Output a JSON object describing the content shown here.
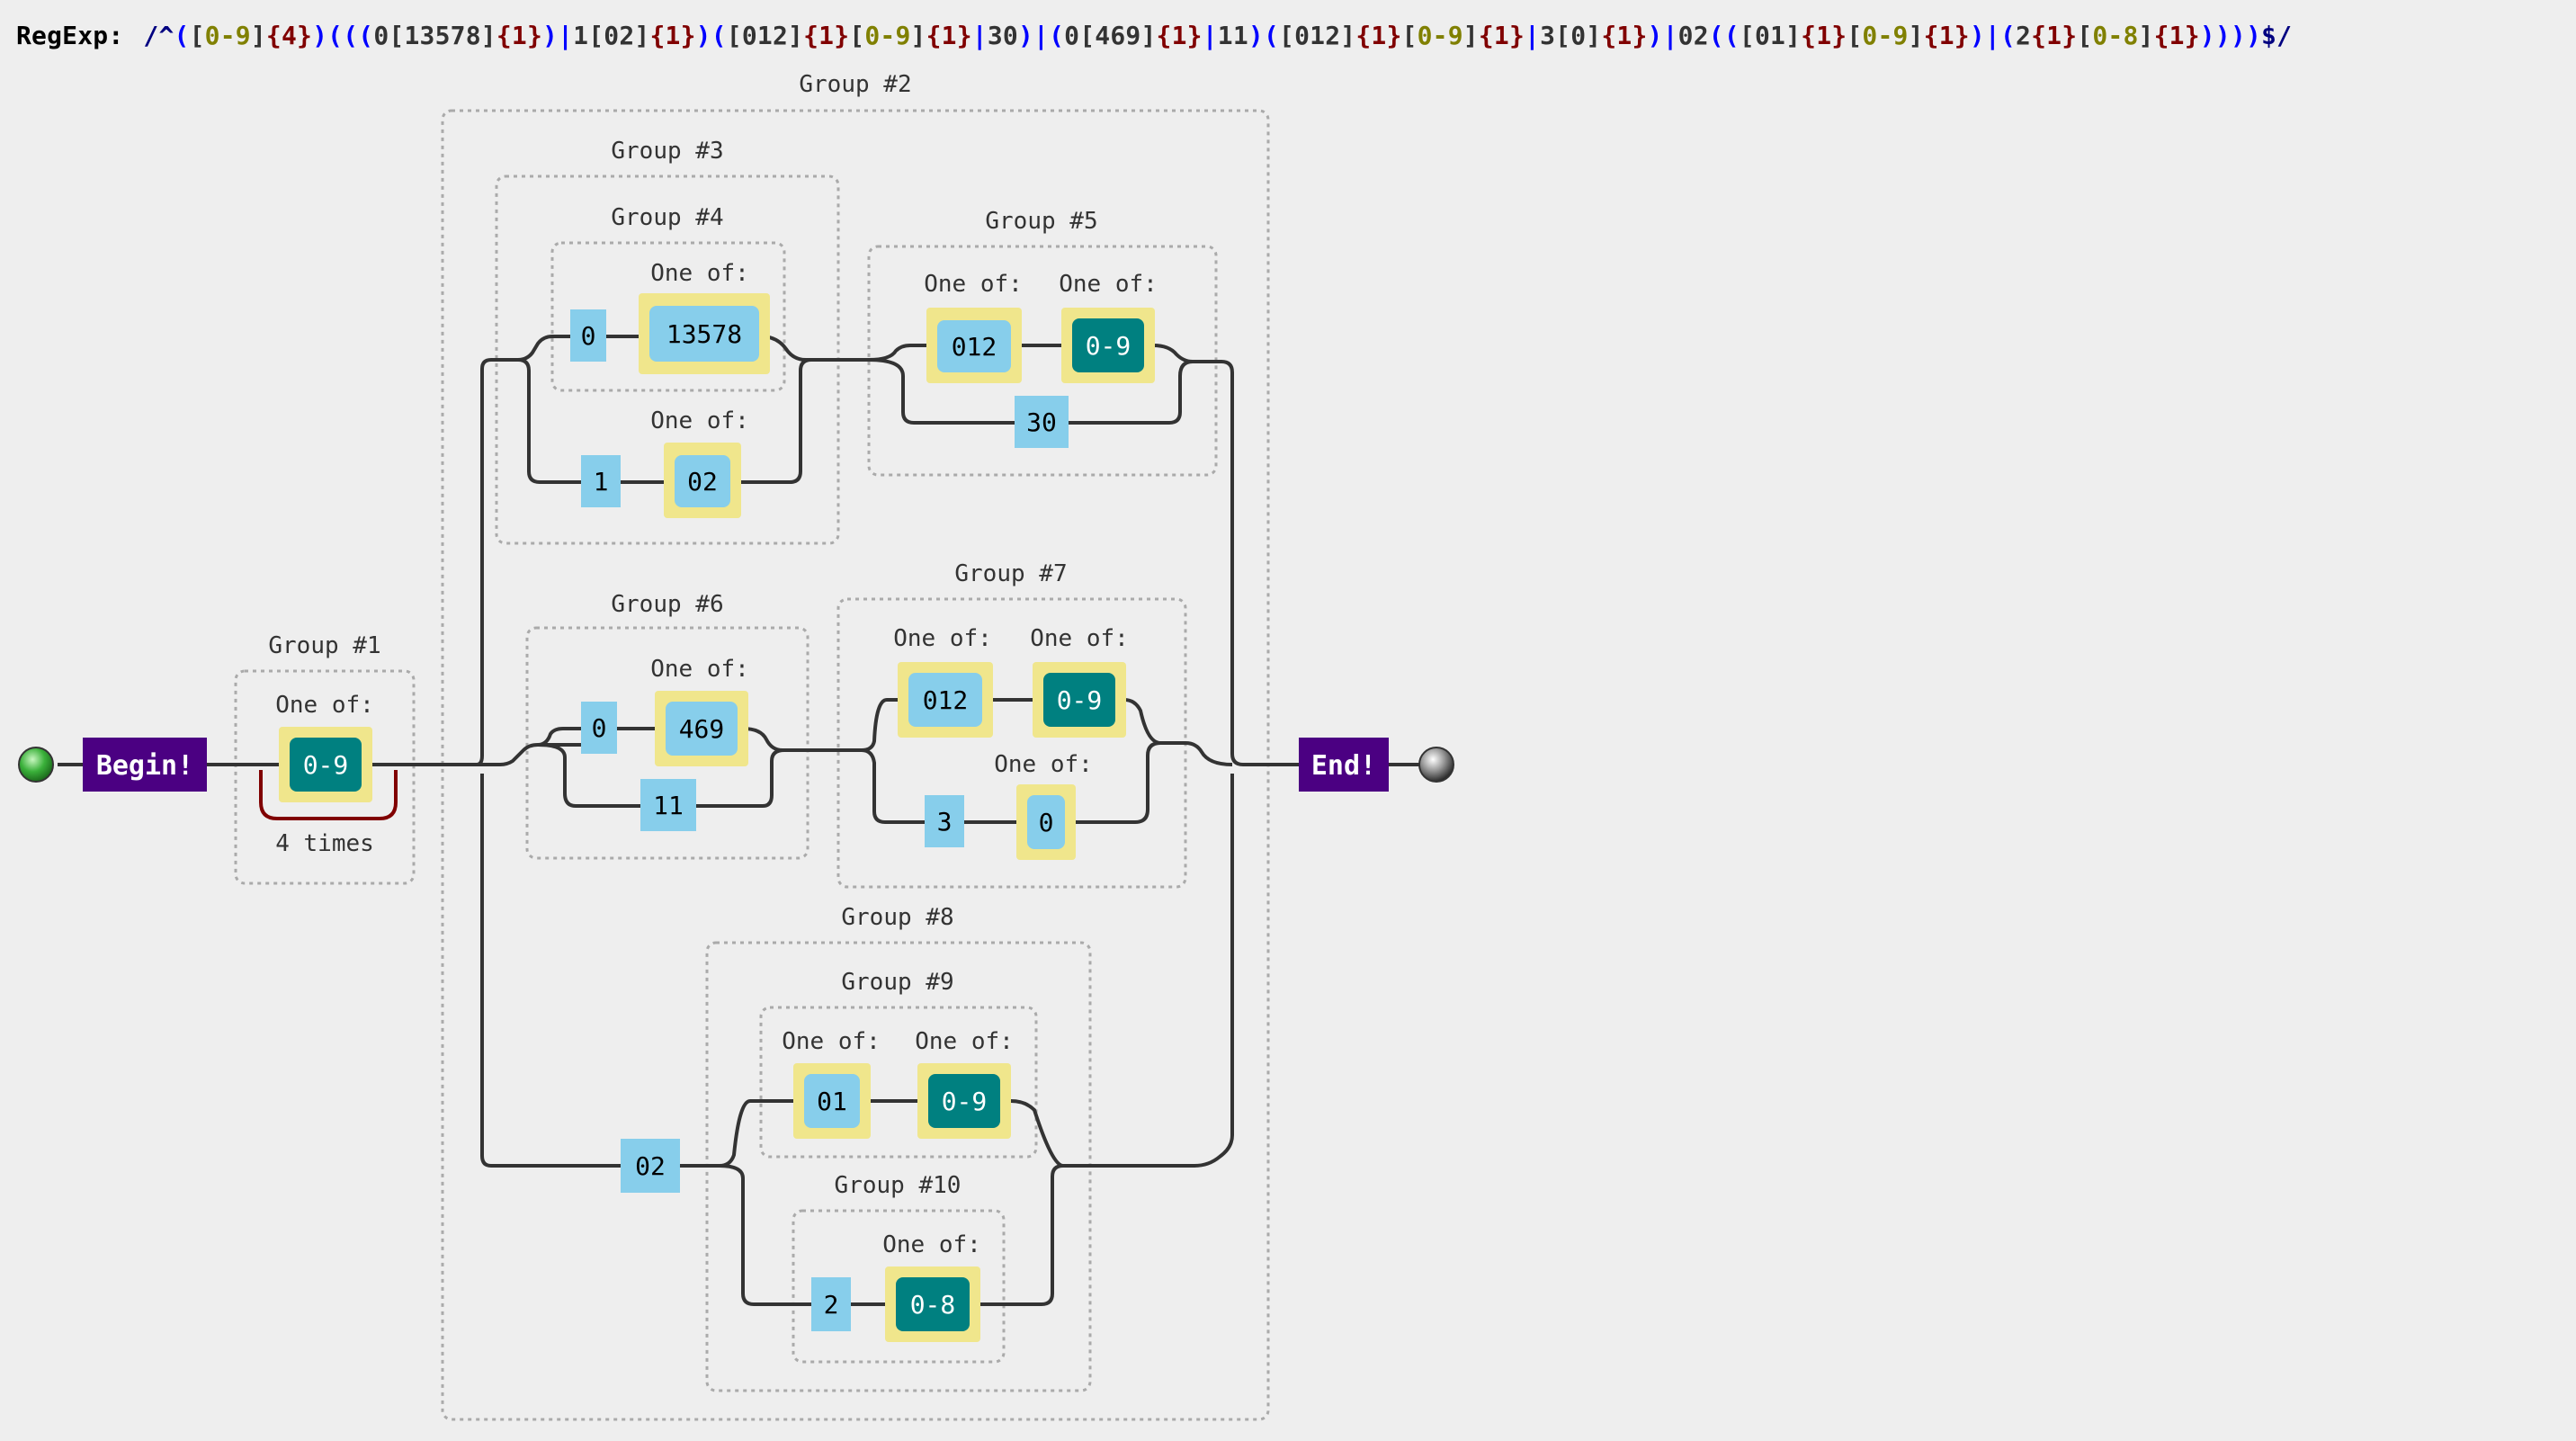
{
  "header": {
    "label": "RegExp:",
    "tokens": [
      {
        "t": "/^",
        "c": "#000080"
      },
      {
        "t": "(",
        "c": "#0000ff"
      },
      {
        "t": "[",
        "c": "#333333"
      },
      {
        "t": "0-9",
        "c": "#808000"
      },
      {
        "t": "]",
        "c": "#333333"
      },
      {
        "t": "{4}",
        "c": "#800000"
      },
      {
        "t": ")",
        "c": "#0000ff"
      },
      {
        "t": "(((",
        "c": "#0000ff"
      },
      {
        "t": "0",
        "c": "#333333"
      },
      {
        "t": "[",
        "c": "#333333"
      },
      {
        "t": "13578",
        "c": "#333333"
      },
      {
        "t": "]",
        "c": "#333333"
      },
      {
        "t": "{1}",
        "c": "#800000"
      },
      {
        "t": ")",
        "c": "#0000ff"
      },
      {
        "t": "|",
        "c": "#0000ff"
      },
      {
        "t": "1",
        "c": "#333333"
      },
      {
        "t": "[",
        "c": "#333333"
      },
      {
        "t": "02",
        "c": "#333333"
      },
      {
        "t": "]",
        "c": "#333333"
      },
      {
        "t": "{1}",
        "c": "#800000"
      },
      {
        "t": ")",
        "c": "#0000ff"
      },
      {
        "t": "(",
        "c": "#0000ff"
      },
      {
        "t": "[",
        "c": "#333333"
      },
      {
        "t": "012",
        "c": "#333333"
      },
      {
        "t": "]",
        "c": "#333333"
      },
      {
        "t": "{1}",
        "c": "#800000"
      },
      {
        "t": "[",
        "c": "#333333"
      },
      {
        "t": "0-9",
        "c": "#808000"
      },
      {
        "t": "]",
        "c": "#333333"
      },
      {
        "t": "{1}",
        "c": "#800000"
      },
      {
        "t": "|",
        "c": "#0000ff"
      },
      {
        "t": "30",
        "c": "#333333"
      },
      {
        "t": ")",
        "c": "#0000ff"
      },
      {
        "t": "|",
        "c": "#0000ff"
      },
      {
        "t": "(",
        "c": "#0000ff"
      },
      {
        "t": "0",
        "c": "#333333"
      },
      {
        "t": "[",
        "c": "#333333"
      },
      {
        "t": "469",
        "c": "#333333"
      },
      {
        "t": "]",
        "c": "#333333"
      },
      {
        "t": "{1}",
        "c": "#800000"
      },
      {
        "t": "|",
        "c": "#0000ff"
      },
      {
        "t": "11",
        "c": "#333333"
      },
      {
        "t": ")",
        "c": "#0000ff"
      },
      {
        "t": "(",
        "c": "#0000ff"
      },
      {
        "t": "[",
        "c": "#333333"
      },
      {
        "t": "012",
        "c": "#333333"
      },
      {
        "t": "]",
        "c": "#333333"
      },
      {
        "t": "{1}",
        "c": "#800000"
      },
      {
        "t": "[",
        "c": "#333333"
      },
      {
        "t": "0-9",
        "c": "#808000"
      },
      {
        "t": "]",
        "c": "#333333"
      },
      {
        "t": "{1}",
        "c": "#800000"
      },
      {
        "t": "|",
        "c": "#0000ff"
      },
      {
        "t": "3",
        "c": "#333333"
      },
      {
        "t": "[",
        "c": "#333333"
      },
      {
        "t": "0",
        "c": "#333333"
      },
      {
        "t": "]",
        "c": "#333333"
      },
      {
        "t": "{1}",
        "c": "#800000"
      },
      {
        "t": ")",
        "c": "#0000ff"
      },
      {
        "t": "|",
        "c": "#0000ff"
      },
      {
        "t": "02",
        "c": "#333333"
      },
      {
        "t": "((",
        "c": "#0000ff"
      },
      {
        "t": "[",
        "c": "#333333"
      },
      {
        "t": "01",
        "c": "#333333"
      },
      {
        "t": "]",
        "c": "#333333"
      },
      {
        "t": "{1}",
        "c": "#800000"
      },
      {
        "t": "[",
        "c": "#333333"
      },
      {
        "t": "0-9",
        "c": "#808000"
      },
      {
        "t": "]",
        "c": "#333333"
      },
      {
        "t": "{1}",
        "c": "#800000"
      },
      {
        "t": ")",
        "c": "#0000ff"
      },
      {
        "t": "|",
        "c": "#0000ff"
      },
      {
        "t": "(",
        "c": "#0000ff"
      },
      {
        "t": "2",
        "c": "#333333"
      },
      {
        "t": "{1}",
        "c": "#800000"
      },
      {
        "t": "[",
        "c": "#333333"
      },
      {
        "t": "0-8",
        "c": "#808000"
      },
      {
        "t": "]",
        "c": "#333333"
      },
      {
        "t": "{1}",
        "c": "#800000"
      },
      {
        "t": ")))",
        "c": "#0000ff"
      },
      {
        "t": ")",
        "c": "#0000ff"
      },
      {
        "t": "$/",
        "c": "#000080"
      }
    ]
  },
  "colors": {
    "line": "#333333",
    "literal": "#87ceeb",
    "charclass": "#f0e68c",
    "range": "#008080",
    "group_border": "#aaaaaa",
    "terminal": "#4b0082",
    "repeat": "#800000",
    "text": "#333333"
  },
  "diagram": {
    "begin_label": "Begin!",
    "end_label": "End!",
    "groups": {
      "g1": "Group #1",
      "g2": "Group #2",
      "g3": "Group #3",
      "g4": "Group #4",
      "g5": "Group #5",
      "g6": "Group #6",
      "g7": "Group #7",
      "g8": "Group #8",
      "g9": "Group #9",
      "g10": "Group #10"
    },
    "one_of_label": "One of:",
    "repeat_label": "4 times",
    "literals": {
      "g4_zero": "0",
      "g3_one": "1",
      "g5_thirty": "30",
      "g6_zero": "0",
      "g6_eleven": "11",
      "g7_three": "3",
      "g2_zero_two": "02",
      "g10_two": "2"
    },
    "charsets": {
      "g1_range": "0-9",
      "g4_set": "13578",
      "g3_set": "02",
      "g5_set": "012",
      "g5_range": "0-9",
      "g6_set": "469",
      "g7_set": "012",
      "g7_range": "0-9",
      "g7_zero": "0",
      "g9_set": "01",
      "g9_range": "0-9",
      "g10_range": "0-8"
    }
  }
}
